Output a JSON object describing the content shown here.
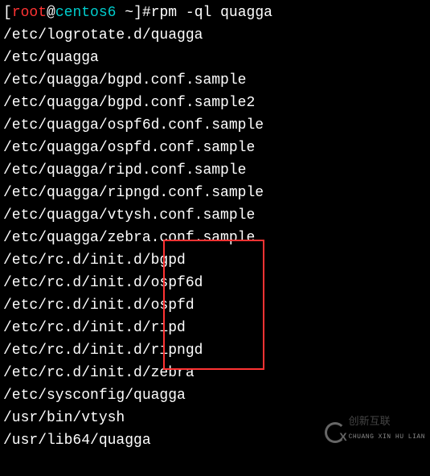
{
  "prompt": {
    "open": "[",
    "user": "root",
    "at": "@",
    "host": "centos6",
    "path": " ~",
    "close": "]",
    "hash": "#"
  },
  "command": "rpm -ql quagga",
  "lines": [
    "/etc/logrotate.d/quagga",
    "/etc/quagga",
    "/etc/quagga/bgpd.conf.sample",
    "/etc/quagga/bgpd.conf.sample2",
    "/etc/quagga/ospf6d.conf.sample",
    "/etc/quagga/ospfd.conf.sample",
    "/etc/quagga/ripd.conf.sample",
    "/etc/quagga/ripngd.conf.sample",
    "/etc/quagga/vtysh.conf.sample",
    "/etc/quagga/zebra.conf.sample",
    "/etc/rc.d/init.d/bgpd",
    "/etc/rc.d/init.d/ospf6d",
    "/etc/rc.d/init.d/ospfd",
    "/etc/rc.d/init.d/ripd",
    "/etc/rc.d/init.d/ripngd",
    "/etc/rc.d/init.d/zebra",
    "/etc/sysconfig/quagga",
    "/usr/bin/vtysh",
    "/usr/lib64/quagga"
  ],
  "watermark": {
    "text": "创新互联",
    "sub": "CHUANG XIN HU LIAN"
  }
}
